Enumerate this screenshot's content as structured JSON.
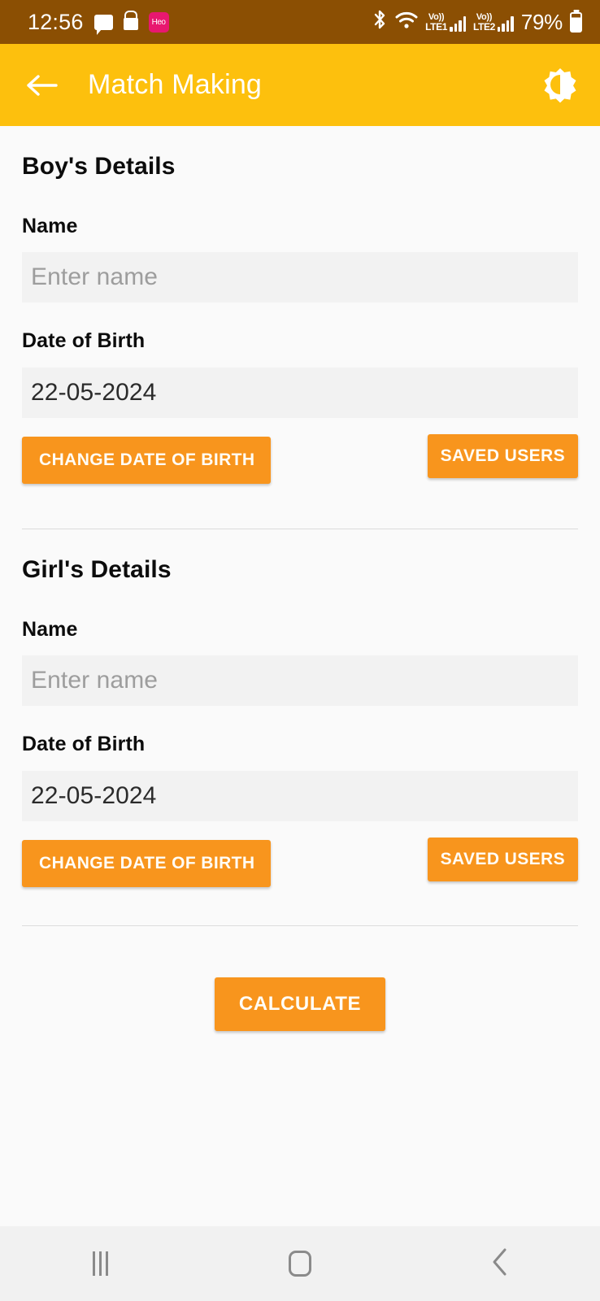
{
  "status_bar": {
    "time": "12:56",
    "battery_percent": "79%",
    "icons": [
      "message-icon",
      "lock-icon",
      "heo-badge-icon",
      "bluetooth-icon",
      "wifi-icon",
      "volte-lte1-icon",
      "signal-bars-1-icon",
      "volte-lte2-icon",
      "signal-bars-2-icon",
      "battery-icon"
    ],
    "heo_badge_label": "Heo",
    "volte1_top": "Vo))",
    "volte1_bottom": "LTE1",
    "volte2_top": "Vo))",
    "volte2_bottom": "LTE2",
    "background_color": "#8b4f03"
  },
  "app_bar": {
    "title": "Match Making",
    "back_icon": "back-arrow-icon",
    "theme_toggle_icon": "brightness-contrast-icon",
    "background_color": "#fdc00d",
    "text_color": "#ffffff"
  },
  "boy_section": {
    "title": "Boy's Details",
    "name_label": "Name",
    "name_value": "",
    "name_placeholder": "Enter name",
    "dob_label": "Date of Birth",
    "dob_value": "22-05-2024",
    "change_dob_button": "CHANGE DATE OF BIRTH",
    "saved_users_button": "SAVED USERS"
  },
  "girl_section": {
    "title": "Girl's Details",
    "name_label": "Name",
    "name_value": "",
    "name_placeholder": "Enter name",
    "dob_label": "Date of Birth",
    "dob_value": "22-05-2024",
    "change_dob_button": "CHANGE DATE OF BIRTH",
    "saved_users_button": "SAVED USERS"
  },
  "actions": {
    "calculate_button": "CALCULATE"
  },
  "theme": {
    "accent_orange": "#f8951d",
    "app_bar_yellow": "#fdc00d",
    "status_brown": "#8b4f03",
    "page_background": "#fafafa",
    "field_background": "#f2f2f2",
    "placeholder_color": "#9d9d9d",
    "divider_color": "#dcdcdc"
  },
  "nav_bar": {
    "recents_icon": "recents-icon",
    "home_icon": "home-icon",
    "back_icon": "nav-back-icon",
    "background_color": "#f1f1f1"
  }
}
